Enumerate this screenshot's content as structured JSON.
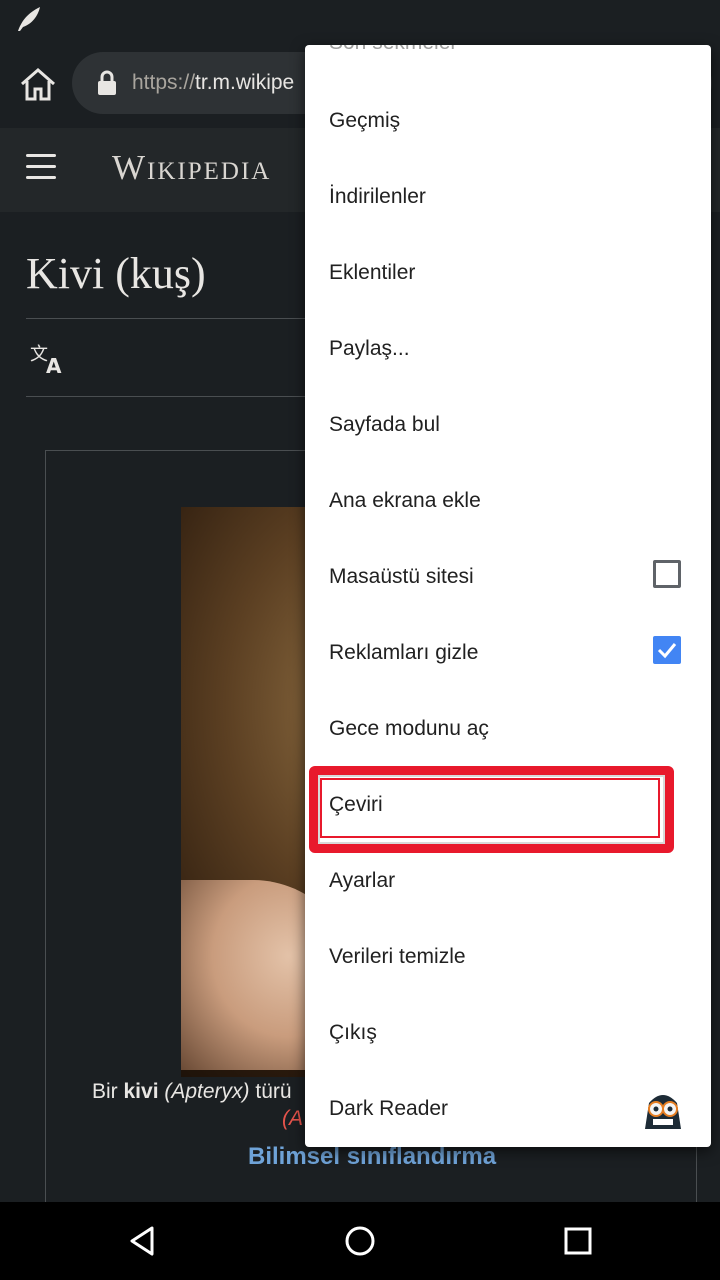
{
  "browser": {
    "url_scheme": "https://",
    "url_host": "tr.m.wikipe"
  },
  "wiki": {
    "logo": "Wikipedia",
    "page_title": "Kivi (kuş)",
    "caption": {
      "prefix": "Bir ",
      "bold": "kivi",
      "italic": " (Apteryx)",
      "suffix": " türü",
      "red_fragment": "(A"
    },
    "sci_class": "Bilimsel sınıflandırma"
  },
  "menu": {
    "partial_top": "Son sekmeler",
    "items": [
      {
        "label": "Geçmiş"
      },
      {
        "label": "İndirilenler"
      },
      {
        "label": "Eklentiler"
      },
      {
        "label": "Paylaş..."
      },
      {
        "label": "Sayfada bul"
      },
      {
        "label": "Ana ekrana ekle"
      },
      {
        "label": "Masaüstü sitesi",
        "checkbox": false
      },
      {
        "label": "Reklamları gizle",
        "checkbox": true
      },
      {
        "label": "Gece modunu aç"
      },
      {
        "label": "Çeviri",
        "highlighted": true
      },
      {
        "label": "Ayarlar"
      },
      {
        "label": "Verileri temizle"
      },
      {
        "label": "Çıkış"
      },
      {
        "label": "Dark Reader",
        "icon": "dark-reader-icon"
      }
    ]
  },
  "colors": {
    "highlight": "#e8192c",
    "checkbox_checked": "#4285f4",
    "link": "#6fa3d8"
  }
}
